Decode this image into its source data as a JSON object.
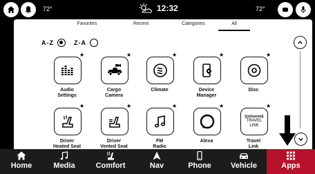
{
  "status_bar": {
    "left_temp": "72°",
    "right_temp": "72°",
    "time": "12:32"
  },
  "tabs": [
    {
      "label": "Favorites"
    },
    {
      "label": "Recent"
    },
    {
      "label": "Categories"
    },
    {
      "label": "All",
      "active": true
    }
  ],
  "sort": {
    "az_label": "A-Z",
    "za_label": "Z-A",
    "selected": "A-Z"
  },
  "apps": [
    {
      "label": "Audio\nSettings",
      "icon": "audio-settings-icon",
      "favorite": true
    },
    {
      "label": "Cargo\nCamera",
      "icon": "cargo-camera-icon",
      "favorite": true
    },
    {
      "label": "Climate",
      "icon": "climate-icon",
      "favorite": true
    },
    {
      "label": "Device\nManager",
      "icon": "device-manager-icon",
      "favorite": true
    },
    {
      "label": "Disc",
      "icon": "disc-icon",
      "favorite": true
    },
    {
      "label": "Driver\nHeated Seat",
      "icon": "heated-seat-icon",
      "favorite": true
    },
    {
      "label": "Driver\nVented Seat",
      "icon": "vented-seat-icon",
      "favorite": true
    },
    {
      "label": "FM\nRadio",
      "icon": "music-note-icon",
      "favorite": true
    },
    {
      "label": "Alexa",
      "icon": "alexa-icon",
      "favorite": true
    },
    {
      "label": "Travel\nLink",
      "icon": "travel-link-icon",
      "favorite": true,
      "badge_top": "((siriusxm))",
      "badge_main": "TRAVEL\nLINK"
    }
  ],
  "nav": [
    {
      "label": "Home",
      "icon": "home-icon"
    },
    {
      "label": "Media",
      "icon": "music-note-icon"
    },
    {
      "label": "Comfort",
      "icon": "comfort-seat-icon"
    },
    {
      "label": "Nav",
      "icon": "navigation-arrow-icon"
    },
    {
      "label": "Phone",
      "icon": "phone-icon"
    },
    {
      "label": "Vehicle",
      "icon": "vehicle-icon"
    },
    {
      "label": "Apps",
      "icon": "apps-grid-icon",
      "active": true
    }
  ],
  "colors": {
    "accent": "#b5112b",
    "nav_bg": "#1c1c1c",
    "panel_bg": "#ffffff"
  }
}
